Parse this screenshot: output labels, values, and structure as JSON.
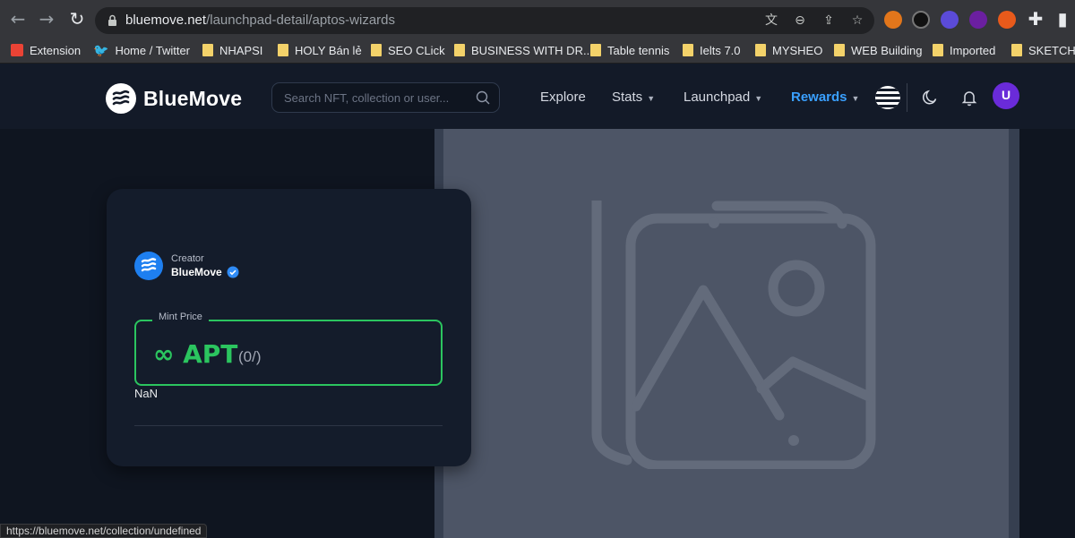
{
  "browser": {
    "url_host": "bluemove.net",
    "url_path": "/launchpad-detail/aptos-wizards",
    "bookmarks": [
      {
        "label": "Extension"
      },
      {
        "label": "Home / Twitter"
      },
      {
        "label": "NHAPSI"
      },
      {
        "label": "HOLY Bán lẻ"
      },
      {
        "label": "SEO CLick"
      },
      {
        "label": "BUSINESS WITH DR..."
      },
      {
        "label": "Table tennis"
      },
      {
        "label": "Ielts 7.0"
      },
      {
        "label": "MYSHEO"
      },
      {
        "label": "WEB Building"
      },
      {
        "label": "Imported"
      },
      {
        "label": "SKETCHU"
      }
    ],
    "status_url": "https://bluemove.net/collection/undefined"
  },
  "header": {
    "brand": "BlueMove",
    "search_placeholder": "Search NFT, collection or user...",
    "nav": {
      "explore": "Explore",
      "stats": "Stats",
      "launchpad": "Launchpad",
      "rewards": "Rewards"
    },
    "avatar_letter": "U"
  },
  "card": {
    "creator_label": "Creator",
    "creator_name": "BlueMove",
    "mint_label": "Mint Price",
    "mint_price": "∞ APT",
    "mint_count": "(0/)",
    "nan_text": "NaN"
  },
  "colors": {
    "accent_green": "#2bc55f",
    "rewards_blue": "#3aa0ff",
    "header_bg": "#131a28",
    "placeholder_panel": "#4d5566"
  }
}
